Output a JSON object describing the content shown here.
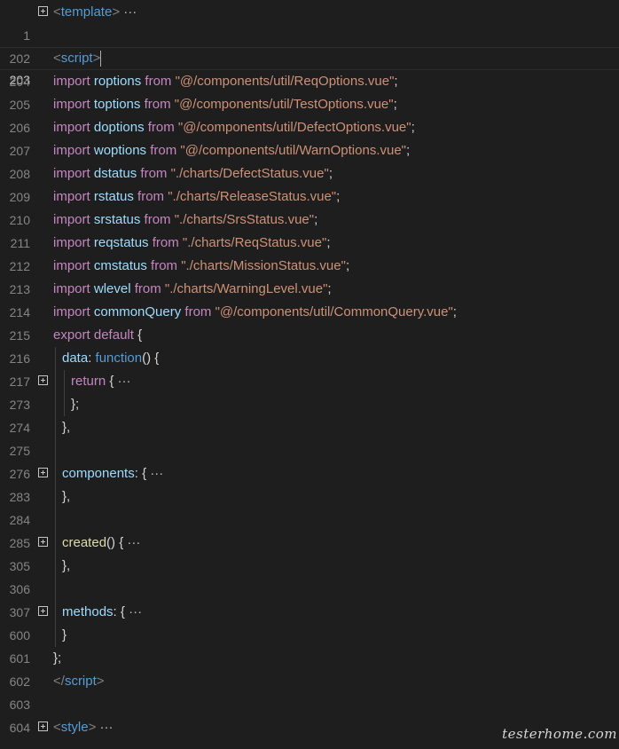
{
  "lines": [
    {
      "n": "1",
      "fold": true,
      "text": {
        "open": "<",
        "tag": "template",
        "close": ">",
        "dots": " ···"
      }
    },
    {
      "n": "202"
    },
    {
      "n": "203",
      "current": true,
      "text": {
        "open": "<",
        "tag": "script",
        "close": ">"
      }
    },
    {
      "n": "204",
      "imp": {
        "kw": "import",
        "name": "roptions",
        "from": "from",
        "path": "\"@/components/util/ReqOptions.vue\""
      }
    },
    {
      "n": "205",
      "imp": {
        "kw": "import",
        "name": "toptions",
        "from": "from",
        "path": "\"@/components/util/TestOptions.vue\""
      }
    },
    {
      "n": "206",
      "imp": {
        "kw": "import",
        "name": "doptions",
        "from": "from",
        "path": "\"@/components/util/DefectOptions.vue\""
      }
    },
    {
      "n": "207",
      "imp": {
        "kw": "import",
        "name": "woptions",
        "from": "from",
        "path": "\"@/components/util/WarnOptions.vue\""
      }
    },
    {
      "n": "208",
      "imp": {
        "kw": "import",
        "name": "dstatus",
        "from": "from",
        "path": "\"./charts/DefectStatus.vue\""
      }
    },
    {
      "n": "209",
      "imp": {
        "kw": "import",
        "name": "rstatus",
        "from": "from",
        "path": "\"./charts/ReleaseStatus.vue\""
      }
    },
    {
      "n": "210",
      "imp": {
        "kw": "import",
        "name": "srstatus",
        "from": "from",
        "path": "\"./charts/SrsStatus.vue\""
      }
    },
    {
      "n": "211",
      "imp": {
        "kw": "import",
        "name": "reqstatus",
        "from": "from",
        "path": "\"./charts/ReqStatus.vue\""
      }
    },
    {
      "n": "212",
      "imp": {
        "kw": "import",
        "name": "cmstatus",
        "from": "from",
        "path": "\"./charts/MissionStatus.vue\""
      }
    },
    {
      "n": "213",
      "imp": {
        "kw": "import",
        "name": "wlevel",
        "from": "from",
        "path": "\"./charts/WarningLevel.vue\""
      }
    },
    {
      "n": "214",
      "imp": {
        "kw": "import",
        "name": "commonQuery",
        "from": "from",
        "path": "\"@/components/util/CommonQuery.vue\""
      }
    },
    {
      "n": "215"
    },
    {
      "n": "216"
    },
    {
      "n": "217"
    },
    {
      "n": "273"
    },
    {
      "n": "274"
    },
    {
      "n": "275"
    },
    {
      "n": "276"
    },
    {
      "n": "283"
    },
    {
      "n": "284"
    },
    {
      "n": "285"
    },
    {
      "n": "305"
    },
    {
      "n": "306"
    },
    {
      "n": "307"
    },
    {
      "n": "600"
    },
    {
      "n": "601"
    },
    {
      "n": "602"
    },
    {
      "n": "603"
    },
    {
      "n": "604"
    }
  ],
  "code": {
    "export": "export",
    "default": "default",
    "brace_open": " {",
    "data": "data",
    "colon": ": ",
    "function": "function",
    "parens_brace": "() {",
    "return": "return",
    "return_rest": " {",
    "fold_dots": " ···",
    "close_semicolon": "};",
    "close_comma": "},",
    "components": "components",
    "created": "created",
    "methods": "methods",
    "brace_close": "}",
    "script_close_open": "</",
    "script": "script",
    "gt": ">",
    "style": "style",
    "lt": "<",
    "semicolon": ";",
    "space": " "
  },
  "watermark": "testerhome.com"
}
